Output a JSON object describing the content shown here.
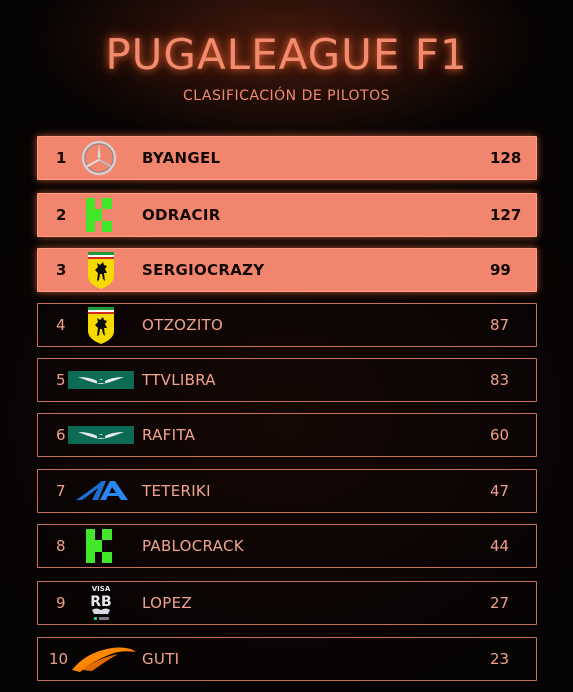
{
  "header": {
    "title": "PUGALEAGUE F1",
    "subtitle": "CLASIFICACIÓN DE PILOTOS"
  },
  "colors": {
    "accent": "#f2856e",
    "border": "#c7735c",
    "background": "#060303"
  },
  "standings": [
    {
      "pos": "1",
      "name": "BYANGEL",
      "points": "128",
      "team_icon": "mercedes-icon",
      "highlight": true
    },
    {
      "pos": "2",
      "name": "ODRACIR",
      "points": "127",
      "team_icon": "kick-sauber-icon",
      "highlight": true
    },
    {
      "pos": "3",
      "name": "SERGIOCRAZY",
      "points": "99",
      "team_icon": "ferrari-icon",
      "highlight": true
    },
    {
      "pos": "4",
      "name": "OTZOZITO",
      "points": "87",
      "team_icon": "ferrari-icon",
      "highlight": false
    },
    {
      "pos": "5",
      "name": "TTVLIBRA",
      "points": "83",
      "team_icon": "aston-martin-icon",
      "highlight": false
    },
    {
      "pos": "6",
      "name": "RAFITA",
      "points": "60",
      "team_icon": "aston-martin-icon",
      "highlight": false
    },
    {
      "pos": "7",
      "name": "TETERIKI",
      "points": "47",
      "team_icon": "alpine-icon",
      "highlight": false
    },
    {
      "pos": "8",
      "name": "PABLOCRACK",
      "points": "44",
      "team_icon": "kick-sauber-icon",
      "highlight": false
    },
    {
      "pos": "9",
      "name": "LOPEZ",
      "points": "27",
      "team_icon": "visa-rb-icon",
      "highlight": false
    },
    {
      "pos": "10",
      "name": "GUTI",
      "points": "23",
      "team_icon": "mclaren-icon",
      "highlight": false
    }
  ],
  "logo_text": {
    "visa_rb_top": "VISA",
    "visa_rb_main": "RB"
  }
}
